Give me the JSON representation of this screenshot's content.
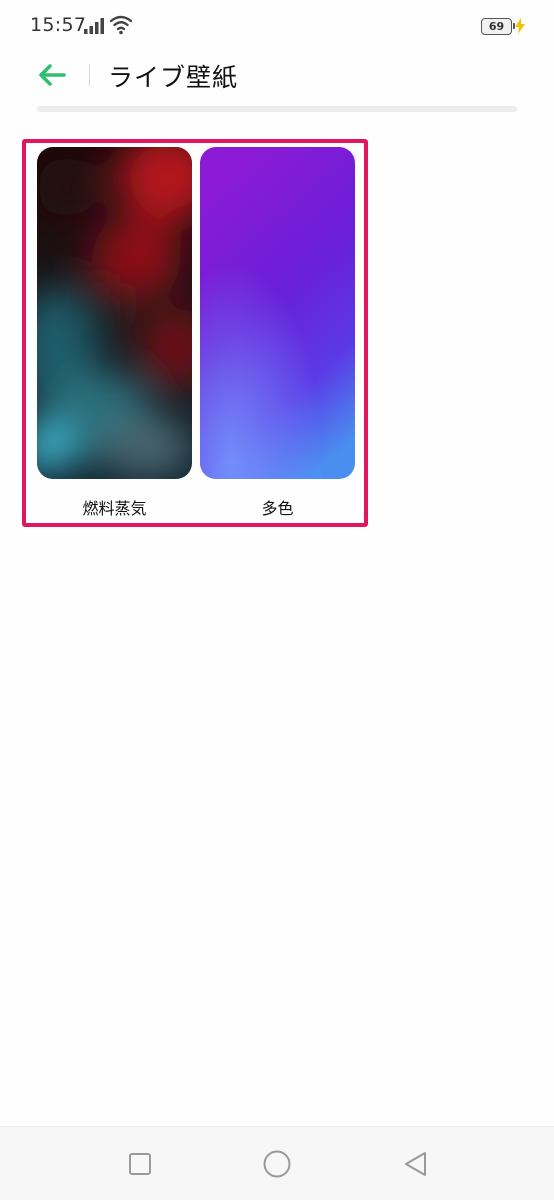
{
  "status_bar": {
    "time": "15:57",
    "battery_level": "69",
    "icons": [
      "signal-icon",
      "wifi-icon",
      "battery-icon",
      "charging-icon"
    ]
  },
  "header": {
    "title": "ライブ壁紙",
    "back_icon": "arrow-left-icon",
    "accent_color": "#2fbf71"
  },
  "wallpapers": [
    {
      "label": "燃料蒸気"
    },
    {
      "label": "多色"
    }
  ],
  "highlight_color": "#e0175f",
  "nav_bar": {
    "icons": [
      "square-recent-icon",
      "circle-home-icon",
      "triangle-back-icon"
    ]
  }
}
